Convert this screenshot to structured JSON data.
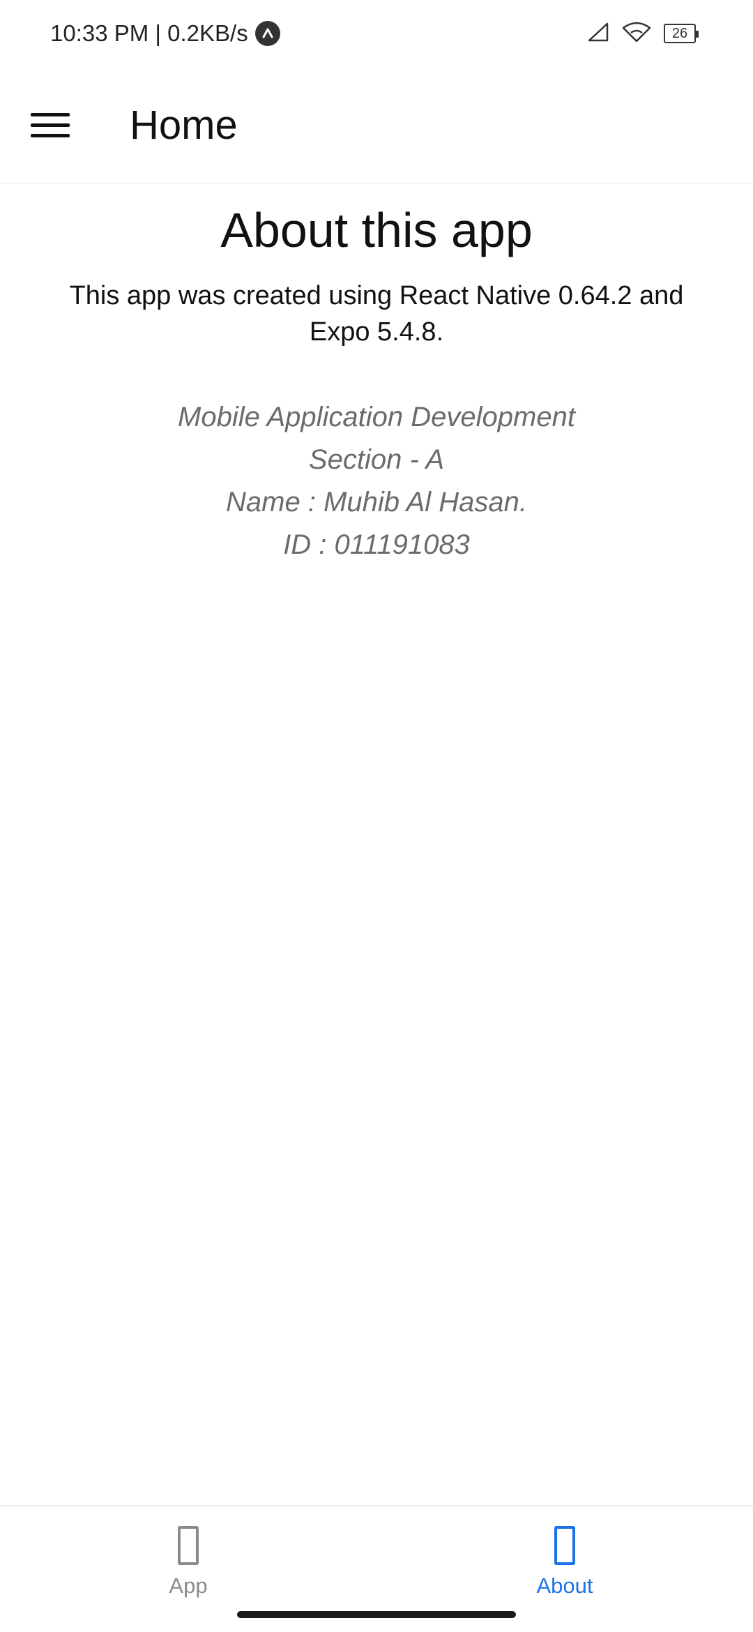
{
  "status_bar": {
    "time": "10:33 PM | 0.2KB/s",
    "battery": "26",
    "icons": [
      "notification-icon",
      "signal-icon",
      "wifi-icon",
      "battery-icon"
    ]
  },
  "header": {
    "title": "Home",
    "menu_icon": "hamburger-menu-icon"
  },
  "about": {
    "title": "About this app",
    "description": "This app was created using React Native 0.64.2 and Expo 5.4.8.",
    "info_lines": [
      "Mobile Application Development",
      "Section - A",
      "Name : Muhib Al Hasan.",
      "ID : 011191083"
    ]
  },
  "tabs": [
    {
      "label": "App",
      "icon": "app-tab-icon",
      "active": false
    },
    {
      "label": "About",
      "icon": "about-tab-icon",
      "active": true
    }
  ],
  "colors": {
    "accent": "#1a73e8",
    "inactive": "#8a8a8a",
    "info_text": "#6b6b6b"
  }
}
